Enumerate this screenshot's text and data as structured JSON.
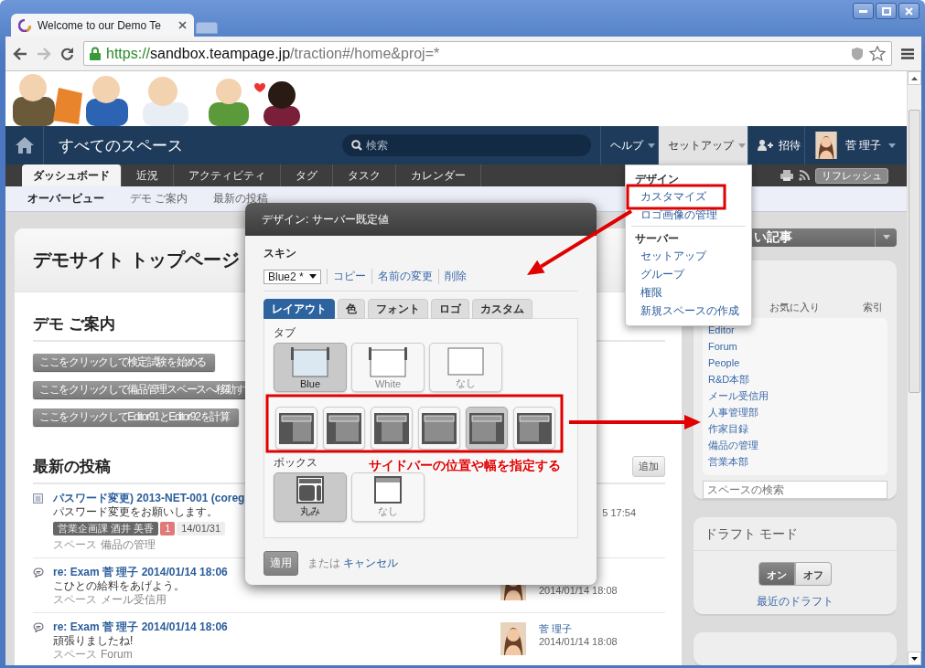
{
  "browser": {
    "tabs": [
      {
        "title": "Welcome to our Demo Te",
        "selected": true
      }
    ],
    "url": {
      "scheme": "https://",
      "host": "sandbox.teampage.jp",
      "path": "/traction#/home&proj=*"
    }
  },
  "navbar": {
    "title": "すべてのスペース",
    "search": {
      "placeholder": "検索"
    },
    "menus": [
      {
        "label": "ヘルプ",
        "selected": false
      },
      {
        "label": "セットアップ",
        "selected": true
      }
    ],
    "invite": "招待",
    "user": "菅 理子"
  },
  "tabs": [
    {
      "label": "ダッシュボード",
      "selected": true
    },
    {
      "label": "近況",
      "selected": false
    },
    {
      "label": "アクティビティ",
      "selected": false
    },
    {
      "label": "タグ",
      "selected": false
    },
    {
      "label": "タスク",
      "selected": false
    },
    {
      "label": "カレンダー",
      "selected": false
    }
  ],
  "refresh": "リフレッシュ",
  "subnav": [
    {
      "label": "オーバービュー",
      "selected": true
    },
    {
      "label": "デモ ご案内",
      "selected": false
    },
    {
      "label": "最新の投稿",
      "selected": false
    }
  ],
  "page": {
    "title": "デモサイト トップページ",
    "guide": {
      "heading": "デモ ご案内",
      "buttons": [
        "ここをクリックして検定試験を始める",
        "ここをクリックして備品管理スペースへ移動す",
        "ここをクリックしてEditor91とEditor92を計算"
      ]
    },
    "posts": {
      "heading": "最新の投稿",
      "add": "追加",
      "items": [
        {
          "kind": "document",
          "title": "パスワード変更) 2013-NET-001 (coreg",
          "excerpt": "パスワード変更をお願いします。",
          "tags": [
            {
              "text": "営業企画課 酒井 美香",
              "kind": "author"
            },
            {
              "text": "1",
              "kind": "count"
            },
            {
              "text": "14/01/31",
              "kind": "date"
            }
          ],
          "space_label": "スペース",
          "space": "備品の管理",
          "date": "5 17:54"
        },
        {
          "kind": "comment",
          "title": "re: Exam 菅 理子 2014/01/14 18:06",
          "excerpt": "こひとの給料をあげよう。",
          "space_label": "スペース",
          "space": "メール受信用",
          "avatar": true,
          "date": "2014/01/14 18:08"
        },
        {
          "kind": "comment",
          "title": "re: Exam 菅 理子 2014/01/14 18:06",
          "excerpt": "頑張りましたね!",
          "space_label": "スペース",
          "space": "Forum",
          "avatar": true,
          "author": "菅 理子",
          "date": "2014/01/14 18:08"
        }
      ]
    }
  },
  "sidebar": {
    "panel_menu": "い記事",
    "spaces": {
      "tabs": [
        {
          "label": "お気に入り",
          "selected": false
        },
        {
          "label": "索引",
          "selected": false
        }
      ],
      "items": [
        "Editor",
        "Forum",
        "People",
        "R&D本部",
        "メール受信用",
        "人事管理部",
        "作家目録",
        "備品の管理",
        "営業本部"
      ],
      "search": {
        "placeholder": "スペースの検索"
      }
    },
    "draft": {
      "heading": "ドラフト モード",
      "toggle": [
        {
          "label": "オン",
          "selected": true
        },
        {
          "label": "オフ",
          "selected": false
        }
      ],
      "link": "最近のドラフト"
    }
  },
  "dialog": {
    "title": "デザイン: サーバー既定値",
    "skin": {
      "label": "スキン",
      "value": "Blue2 *",
      "actions": [
        "コピー",
        "名前の変更",
        "削除"
      ]
    },
    "tabs": [
      {
        "label": "レイアウト",
        "selected": true
      },
      {
        "label": "色",
        "selected": false
      },
      {
        "label": "フォント",
        "selected": false
      },
      {
        "label": "ロゴ",
        "selected": false
      },
      {
        "label": "カスタム",
        "selected": false
      }
    ],
    "tab_style": {
      "label": "タブ",
      "options": [
        {
          "label": "Blue",
          "kind": "blue",
          "selected": true
        },
        {
          "label": "White",
          "kind": "white",
          "selected": false
        },
        {
          "label": "なし",
          "kind": "none",
          "selected": false
        }
      ]
    },
    "sidebar_layout": {
      "options": [
        {
          "selected": false
        },
        {
          "selected": false
        },
        {
          "selected": false
        },
        {
          "selected": false
        },
        {
          "selected": true
        },
        {
          "selected": false
        }
      ]
    },
    "box_style": {
      "label": "ボックス",
      "options": [
        {
          "label": "丸み",
          "kind": "rounded",
          "selected": true
        },
        {
          "label": "なし",
          "kind": "none",
          "selected": false
        }
      ]
    },
    "apply": "適用",
    "or": "または",
    "cancel": "キャンセル"
  },
  "menu": {
    "groups": [
      {
        "heading": "デザイン",
        "items": [
          "カスタマイズ",
          "ロゴ画像の管理"
        ]
      },
      {
        "heading": "サーバー",
        "items": [
          "セットアップ",
          "グループ",
          "権限",
          "新規スペースの作成"
        ]
      }
    ]
  },
  "annotations": [
    {
      "kind": "arrow"
    },
    {
      "kind": "frame"
    },
    {
      "kind": "frame"
    },
    {
      "kind": "arrow"
    },
    {
      "kind": "callout",
      "text": "サイドバーの位置や幅を指定する"
    }
  ]
}
